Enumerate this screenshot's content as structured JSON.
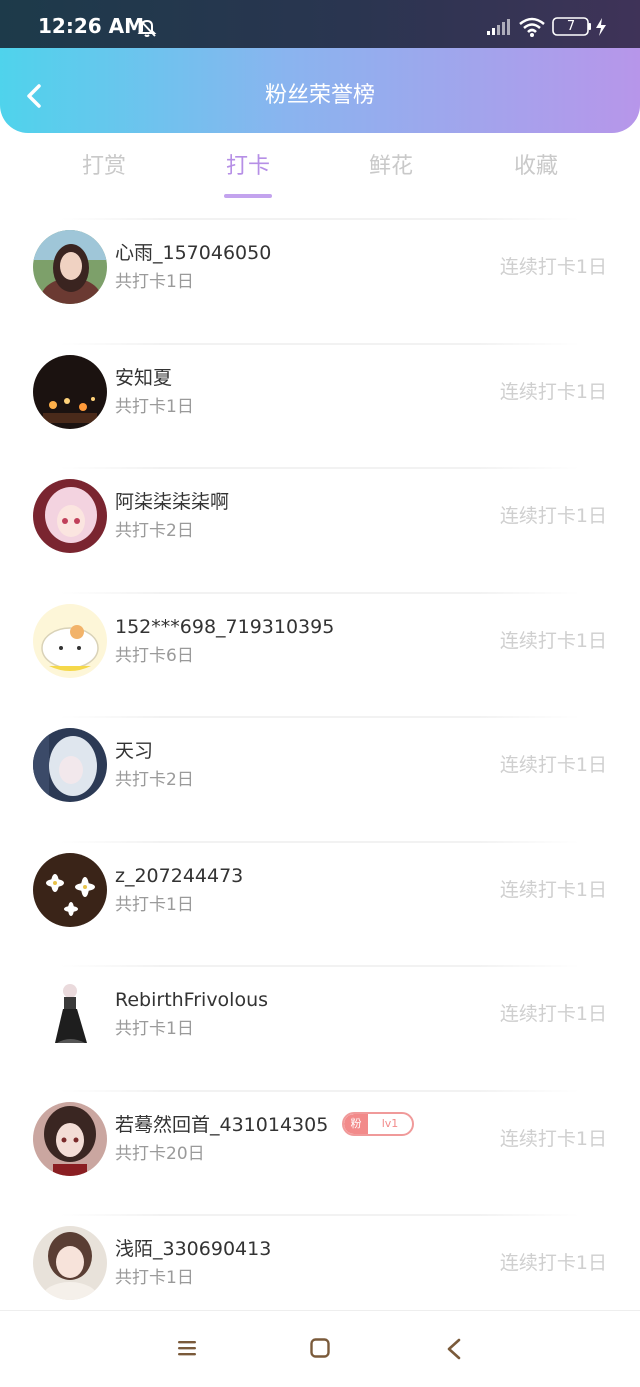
{
  "status_bar": {
    "time": "12:26 AM",
    "battery": "7"
  },
  "header": {
    "title": "粉丝荣誉榜"
  },
  "tabs": [
    {
      "label": "打赏",
      "active": false
    },
    {
      "label": "打卡",
      "active": true
    },
    {
      "label": "鲜花",
      "active": false
    },
    {
      "label": "收藏",
      "active": false
    }
  ],
  "users": [
    {
      "name": "心雨_157046050",
      "total": "共打卡1日",
      "streak": "连续打卡1日"
    },
    {
      "name": "安知夏",
      "total": "共打卡1日",
      "streak": "连续打卡1日"
    },
    {
      "name": "阿柒柒柒柒啊",
      "total": "共打卡2日",
      "streak": "连续打卡1日"
    },
    {
      "name": "152***698_719310395",
      "total": "共打卡6日",
      "streak": "连续打卡1日"
    },
    {
      "name": "天习",
      "total": "共打卡2日",
      "streak": "连续打卡1日"
    },
    {
      "name": "z_207244473",
      "total": "共打卡1日",
      "streak": "连续打卡1日"
    },
    {
      "name": "RebirthFrivolous",
      "total": "共打卡1日",
      "streak": "连续打卡1日"
    },
    {
      "name": "若蓦然回首_431014305",
      "total": "共打卡20日",
      "streak": "连续打卡1日",
      "badge": {
        "tag": "粉",
        "level": "lv1"
      }
    },
    {
      "name": "浅陌_330690413",
      "total": "共打卡1日",
      "streak": "连续打卡1日"
    }
  ],
  "colors": {
    "accent": "#b68fe6",
    "header_start": "#4fd3ec",
    "header_end": "#b796ea",
    "badge": "#f28a8a"
  }
}
